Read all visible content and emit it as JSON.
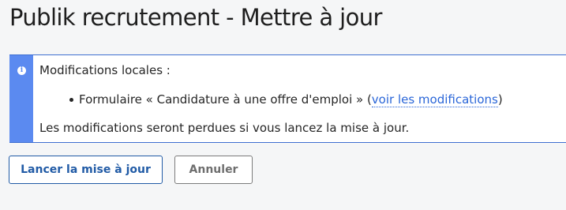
{
  "page": {
    "title": "Publik recrutement - Mettre à jour"
  },
  "notice": {
    "icon": "info-icon",
    "icon_glyph": "i",
    "intro": "Modifications locales :",
    "items": [
      {
        "prefix": "Formulaire « Candidature à une offre d'emploi » (",
        "link_label": "voir les modifications",
        "suffix": ")"
      }
    ],
    "warning": "Les modifications seront perdues si vous lancez la mise à jour.",
    "accent_color": "#5b8af0"
  },
  "actions": {
    "submit_label": "Lancer la mise à jour",
    "cancel_label": "Annuler"
  }
}
